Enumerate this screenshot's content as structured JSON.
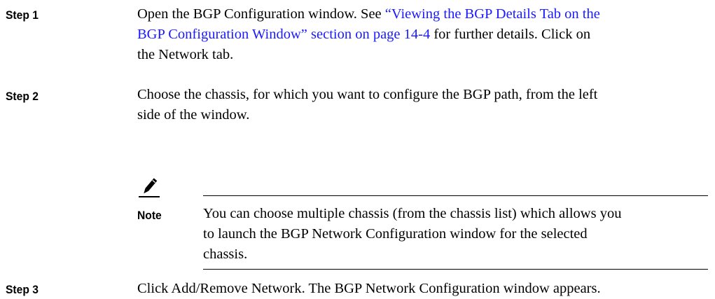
{
  "steps": [
    {
      "label": "Step 1",
      "line1_pre": "Open the BGP Configuration window. See ",
      "link1": "“Viewing the BGP Details Tab on the",
      "link2": "BGP Configuration Window” section on page 14-4",
      "line2_post": " for further details. Click on",
      "line3": "the Network tab."
    },
    {
      "label": "Step 2",
      "line1": "Choose the chassis, for which you want to configure the BGP path, from the left",
      "line2": "side of the window."
    },
    {
      "label": "Step 3",
      "line1": "Click Add/Remove Network. The BGP Network Configuration window appears."
    }
  ],
  "note": {
    "icon": "pencil-note-icon",
    "label": "Note",
    "lines": [
      "You can choose multiple chassis (from the chassis list) which allows you",
      "to launch the BGP Network Configuration window for the selected",
      "chassis."
    ]
  }
}
